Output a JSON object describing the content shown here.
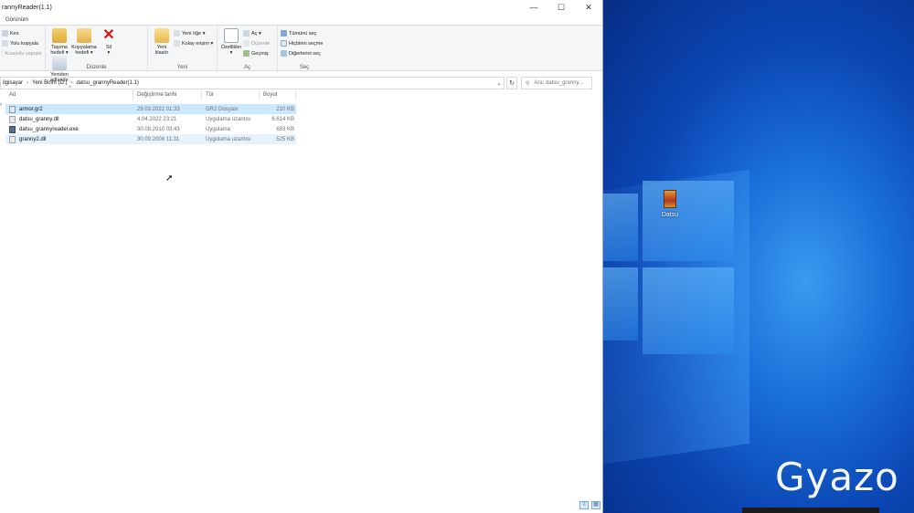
{
  "window": {
    "title": "rannyReader(1.1)",
    "minimize": "—",
    "maximize": "☐",
    "close": "✕"
  },
  "menu": {
    "view_tab": "Görünüm"
  },
  "ribbon": {
    "clipboard": {
      "cut": "Kes",
      "copy_path": "Yolu kopyala",
      "paste_shortcut": "Kısayolu yapıştır"
    },
    "organize": {
      "move_to": "Taşıma\nhedefi ▾",
      "copy_to": "Kopyalama\nhedefi ▾",
      "delete": "Sil\n▾",
      "rename": "Yeniden\nadlandır",
      "label": "Düzenle"
    },
    "new": {
      "new_folder": "Yeni\nklasör",
      "new_item": "Yeni öğe ▾",
      "easy_access": "Kolay erişim ▾",
      "label": "Yeni"
    },
    "open": {
      "properties": "Özellikler\n▾",
      "open": "Aç ▾",
      "edit": "Düzenle",
      "history": "Geçmiş",
      "label": "Aç"
    },
    "select": {
      "select_all": "Tümünü seç",
      "select_none": "Hiçbirini seçme",
      "invert": "Diğerlerini seç",
      "label": "Seç"
    }
  },
  "address": {
    "crumbs": [
      "ilgisayar",
      "Yeni Birim (D:)",
      "datsu_grannyReader(1.1)"
    ],
    "search_placeholder": "Ara: datsu_granny..."
  },
  "columns": {
    "name": "Ad",
    "date": "Değiştirme tarihi",
    "type": "Tür",
    "size": "Boyut"
  },
  "files": [
    {
      "name": "armor.gr2",
      "date": "29.03.2022 01:33",
      "type": "GR2 Dosyası",
      "size": "210 KB"
    },
    {
      "name": "datsu_granny.dll",
      "date": "4.04.2022 23:21",
      "type": "Uygulama uzantısı",
      "size": "6.614 KB"
    },
    {
      "name": "datsu_grannyreader.exe",
      "date": "30.08.2010 03:43",
      "type": "Uygulama",
      "size": "693 KB"
    },
    {
      "name": "granny2.dll",
      "date": "30.09.2008 11:31",
      "type": "Uygulama uzantısı",
      "size": "525 KB"
    }
  ],
  "desktop": {
    "icon_label": "Datsu",
    "watermark": "Gyazo"
  },
  "colors": {
    "selected_row": "#cce8ff",
    "desktop_blue": "#1a6fd8"
  }
}
